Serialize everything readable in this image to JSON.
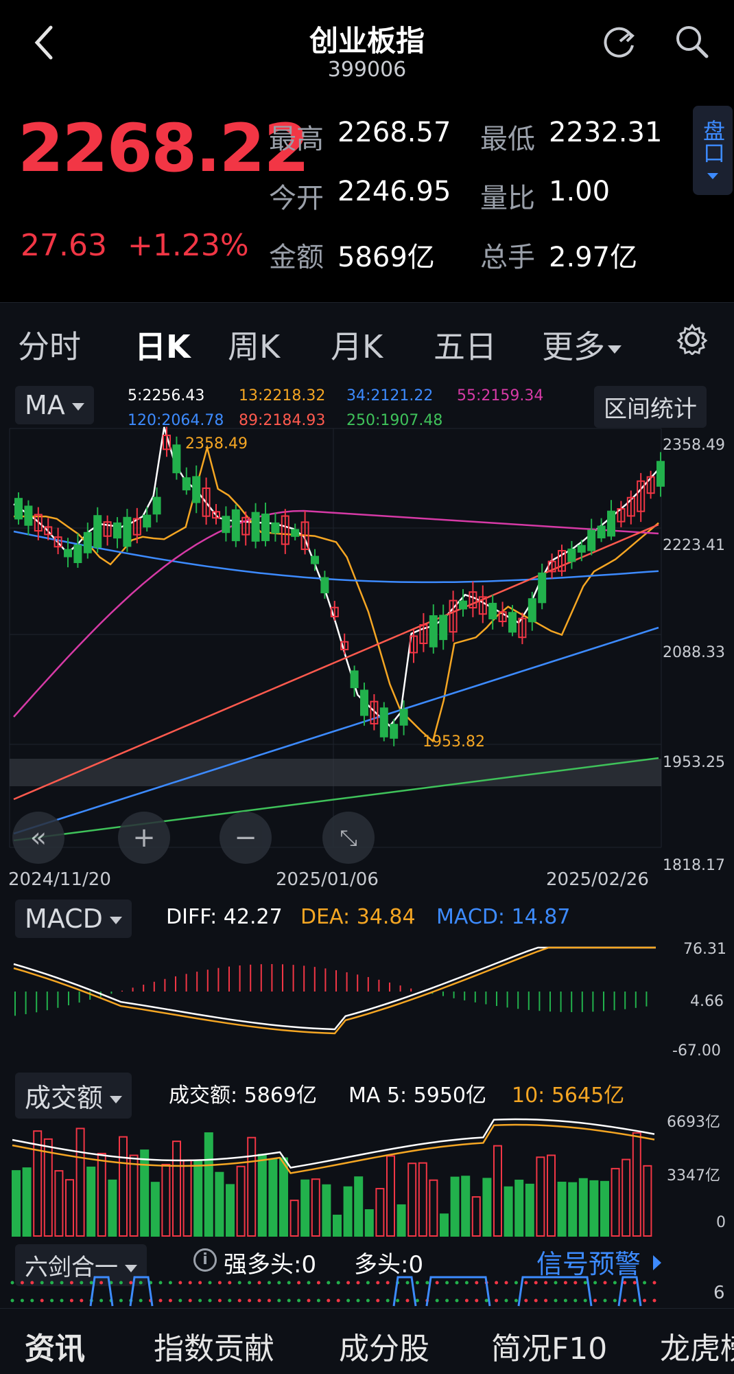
{
  "header": {
    "title": "创业板指",
    "code": "399006"
  },
  "quote": {
    "price": "2268.22",
    "change": "27.63",
    "change_pct": "+1.23%",
    "high_label": "最高",
    "high": "2268.57",
    "low_label": "最低",
    "low": "2232.31",
    "open_label": "今开",
    "open": "2246.95",
    "vol_ratio_label": "量比",
    "vol_ratio": "1.00",
    "amount_label": "金额",
    "amount": "5869亿",
    "hands_label": "总手",
    "hands": "2.97亿",
    "pankou": "盘口"
  },
  "tabs": [
    {
      "label": "分时"
    },
    {
      "label": "日K"
    },
    {
      "label": "周K"
    },
    {
      "label": "月K"
    },
    {
      "label": "五日"
    },
    {
      "label": "更多"
    }
  ],
  "kline": {
    "indicator": "MA",
    "range_button": "区间统计",
    "ma": {
      "ma5": "5:2256.43",
      "ma13": "13:2218.32",
      "ma34": "34:2121.22",
      "ma55": "55:2159.34",
      "ma120": "120:2064.78",
      "ma89": "89:2184.93",
      "ma250": "250:1907.48"
    },
    "y_ticks": [
      "2358.49",
      "2223.41",
      "2088.33",
      "1953.25",
      "1818.17"
    ],
    "x_ticks": [
      "2024/11/20",
      "2025/01/06",
      "2025/02/26"
    ],
    "high_mark": "2358.49",
    "low_mark": "1953.82"
  },
  "macd": {
    "indicator": "MACD",
    "diff": "DIFF: 42.27",
    "dea": "DEA: 34.84",
    "macd": "MACD: 14.87",
    "y_ticks": [
      "76.31",
      "4.66",
      "-67.00"
    ]
  },
  "volume": {
    "indicator": "成交额",
    "amount": "成交额: 5869亿",
    "ma5": "MA 5: 5950亿",
    "ma10": "10: 5645亿",
    "y_ticks": [
      "6693亿",
      "3347亿",
      "0"
    ]
  },
  "signal": {
    "indicator": "六剑合一",
    "strong_bull": "强多头:0",
    "bull": "多头:0",
    "alert": "信号预警",
    "value": "6"
  },
  "bottom_nav": [
    "资讯",
    "指数贡献",
    "成分股",
    "简况F10",
    "龙虎榜"
  ],
  "colors": {
    "up": "#f23645",
    "down": "#22b14c",
    "ma5": "#ffffff",
    "ma13": "#f5a623",
    "ma34": "#3d8bff",
    "ma55": "#d63aa6",
    "ma89": "#ff5a4e",
    "ma250": "#3fc25a"
  }
}
